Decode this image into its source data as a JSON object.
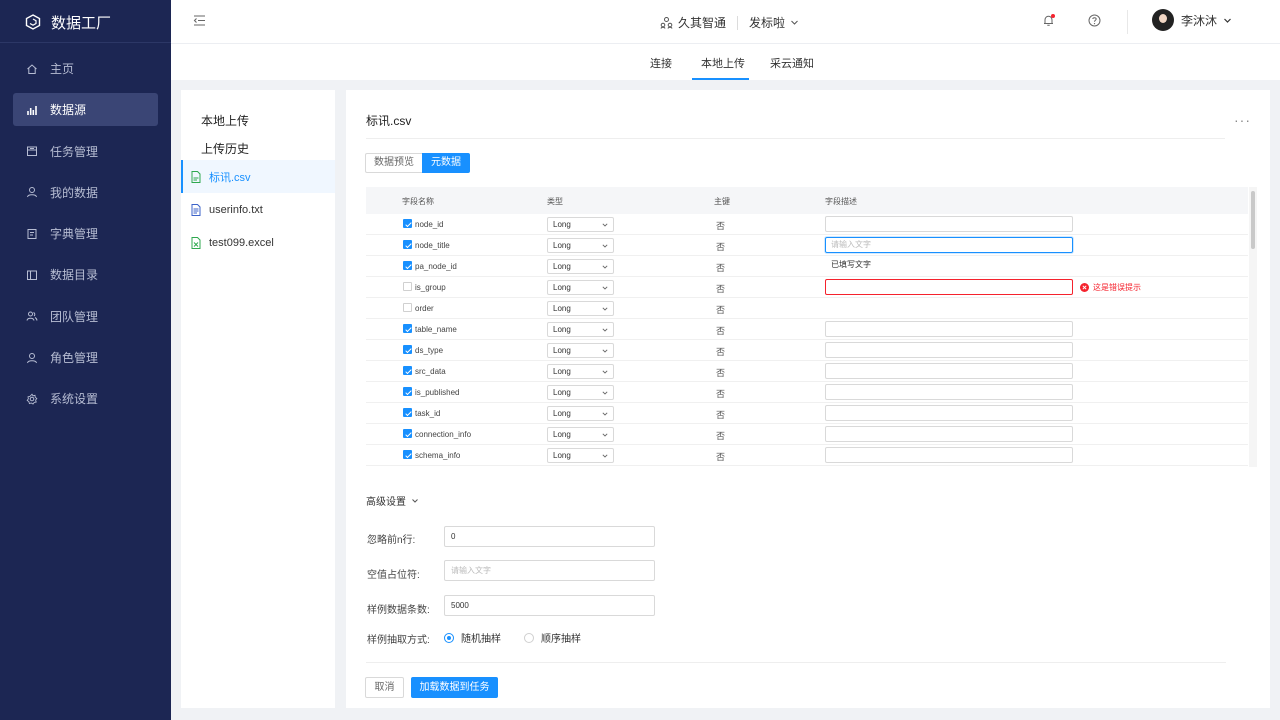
{
  "app": {
    "title": "数据工厂"
  },
  "sidebar": {
    "items": [
      {
        "label": "主页",
        "icon": "home-icon"
      },
      {
        "label": "数据源",
        "icon": "bar-chart-icon",
        "active": true
      },
      {
        "label": "任务管理",
        "icon": "calendar-icon"
      },
      {
        "label": "我的数据",
        "icon": "user-icon"
      },
      {
        "label": "字典管理",
        "icon": "book-icon"
      },
      {
        "label": "数据目录",
        "icon": "database-icon"
      },
      {
        "label": "团队管理",
        "icon": "team-icon"
      },
      {
        "label": "角色管理",
        "icon": "role-icon"
      },
      {
        "label": "系统设置",
        "icon": "gear-icon"
      }
    ]
  },
  "header": {
    "company": "久其智通",
    "project": "发标啦",
    "user": "李沐沐"
  },
  "tabs": [
    {
      "label": "连接"
    },
    {
      "label": "本地上传",
      "active": true
    },
    {
      "label": "采云通知"
    }
  ],
  "left": {
    "upload": "本地上传",
    "history": "上传历史",
    "files": [
      {
        "name": "标讯.csv",
        "active": true
      },
      {
        "name": "userinfo.txt"
      },
      {
        "name": "test099.excel"
      }
    ]
  },
  "main": {
    "title": "标讯.csv",
    "more": "···",
    "seg": {
      "preview": "数据预览",
      "meta": "元数据"
    },
    "table": {
      "headers": {
        "name": "字段名称",
        "type": "类型",
        "pk": "主键",
        "desc": "字段描述"
      },
      "rows": [
        {
          "checked": true,
          "name": "node_id",
          "type": "Long",
          "pk": "否",
          "desc": "",
          "state": "normal"
        },
        {
          "checked": true,
          "name": "node_title",
          "type": "Long",
          "pk": "否",
          "desc": "请输入文字",
          "state": "focus"
        },
        {
          "checked": true,
          "name": "pa_node_id",
          "type": "Long",
          "pk": "否",
          "desc": "已填写文字",
          "state": "plain"
        },
        {
          "checked": false,
          "name": "is_group",
          "type": "Long",
          "pk": "否",
          "desc": "",
          "state": "error",
          "error": "这是错误提示"
        },
        {
          "checked": false,
          "name": "order",
          "type": "Long",
          "pk": "否",
          "desc": "",
          "state": "none"
        },
        {
          "checked": true,
          "name": "table_name",
          "type": "Long",
          "pk": "否",
          "desc": "",
          "state": "normal"
        },
        {
          "checked": true,
          "name": "ds_type",
          "type": "Long",
          "pk": "否",
          "desc": "",
          "state": "normal"
        },
        {
          "checked": true,
          "name": "src_data",
          "type": "Long",
          "pk": "否",
          "desc": "",
          "state": "normal"
        },
        {
          "checked": true,
          "name": "is_published",
          "type": "Long",
          "pk": "否",
          "desc": "",
          "state": "normal"
        },
        {
          "checked": true,
          "name": "task_id",
          "type": "Long",
          "pk": "否",
          "desc": "",
          "state": "normal"
        },
        {
          "checked": true,
          "name": "connection_info",
          "type": "Long",
          "pk": "否",
          "desc": "",
          "state": "normal"
        },
        {
          "checked": true,
          "name": "schema_info",
          "type": "Long",
          "pk": "否",
          "desc": "",
          "state": "normal"
        }
      ]
    },
    "advanced": {
      "title": "高级设置",
      "skip_label": "忽略前n行:",
      "skip_value": "0",
      "null_label": "空值占位符:",
      "null_placeholder": "请输入文字",
      "sample_label": "样例数据条数:",
      "sample_value": "5000",
      "method_label": "样例抽取方式:",
      "method_random": "随机抽样",
      "method_seq": "顺序抽样"
    },
    "footer": {
      "cancel": "取消",
      "submit": "加载数据到任务"
    }
  },
  "colors": {
    "accent": "#1890ff",
    "sidebar": "#1c2653",
    "error": "#f5222d"
  }
}
